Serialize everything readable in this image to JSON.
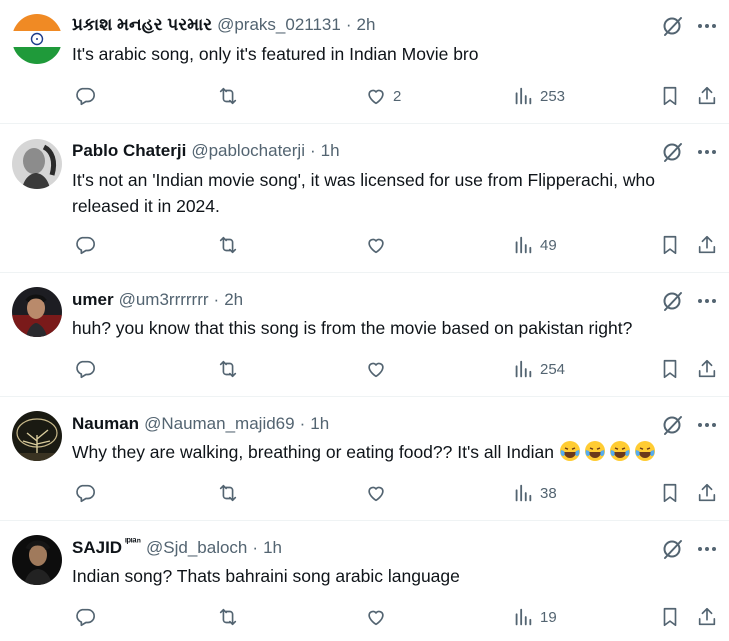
{
  "tweets": [
    {
      "name": "પ્રકાશ મનહર પરમાર",
      "badge": "",
      "handle": "@praks_021131",
      "time": "2h",
      "text": "It's arabic song, only it's featured in Indian Movie bro",
      "reply_count": "",
      "retweet_count": "",
      "like_count": "2",
      "views": "253",
      "avatar": "india-flag"
    },
    {
      "name": "Pablo Chaterji",
      "badge": "",
      "handle": "@pablochaterji",
      "time": "1h",
      "text": "It's not an 'Indian movie song',  it was licensed for use from Flipperachi, who released it in 2024.",
      "reply_count": "",
      "retweet_count": "",
      "like_count": "",
      "views": "49",
      "avatar": "portrait-bw"
    },
    {
      "name": "umer",
      "badge": "",
      "handle": "@um3rrrrrrr",
      "time": "2h",
      "text": "huh? you know that this song is from the movie based on pakistan right?",
      "reply_count": "",
      "retweet_count": "",
      "like_count": "",
      "views": "254",
      "avatar": "portrait-red"
    },
    {
      "name": "Nauman",
      "badge": "",
      "handle": "@Nauman_majid69",
      "time": "1h",
      "text": "Why they are walking, breathing or eating food?? It's all Indian",
      "emoji": [
        "😂",
        "😂",
        "😂",
        "😂"
      ],
      "reply_count": "",
      "retweet_count": "",
      "like_count": "",
      "views": "38",
      "avatar": "tree-night"
    },
    {
      "name": "SAJID",
      "badge": "ᶦᵖᶦᵃⁿ",
      "handle": "@Sjd_baloch",
      "time": "1h",
      "text": "Indian song? Thats bahraini song arabic language",
      "reply_count": "",
      "retweet_count": "",
      "like_count": "",
      "views": "19",
      "avatar": "portrait-dark"
    }
  ],
  "separator": "·",
  "colors": {
    "text": "#0f1419",
    "secondary": "#536471",
    "divider": "#eff3f4"
  },
  "icons": [
    "grok-icon",
    "more-icon",
    "reply-icon",
    "retweet-icon",
    "like-icon",
    "views-icon",
    "bookmark-icon",
    "share-icon"
  ]
}
